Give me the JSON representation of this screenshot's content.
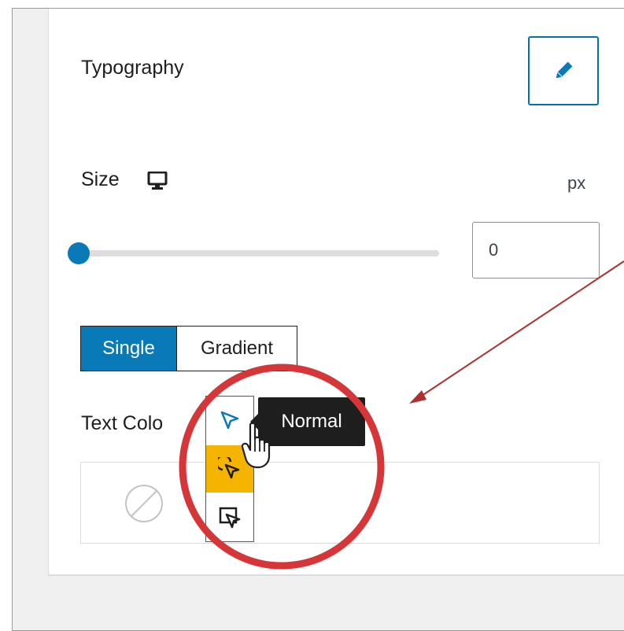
{
  "panel": {
    "section_title": "Typography",
    "size_label": "Size",
    "size_unit": "px",
    "size_value": "0",
    "size_level": 0,
    "color_tabs": [
      {
        "label": "Single",
        "active": true
      },
      {
        "label": "Gradient",
        "active": false
      }
    ],
    "text_color_label": "Text Colo"
  },
  "cursor_picker": {
    "tooltip": "Normal",
    "items": [
      "normal-cursor",
      "hover-cursor",
      "select-cursor"
    ],
    "highlight_color": "#f5b400"
  },
  "colors": {
    "accent": "#0a79b8",
    "annotation_circle": "#d63638",
    "annotation_arrow": "#b03030"
  },
  "icons": {
    "edit": "pencil-icon",
    "device": "desktop-icon",
    "no_color": "no-color-icon",
    "pointer": "hand-pointer-icon"
  }
}
